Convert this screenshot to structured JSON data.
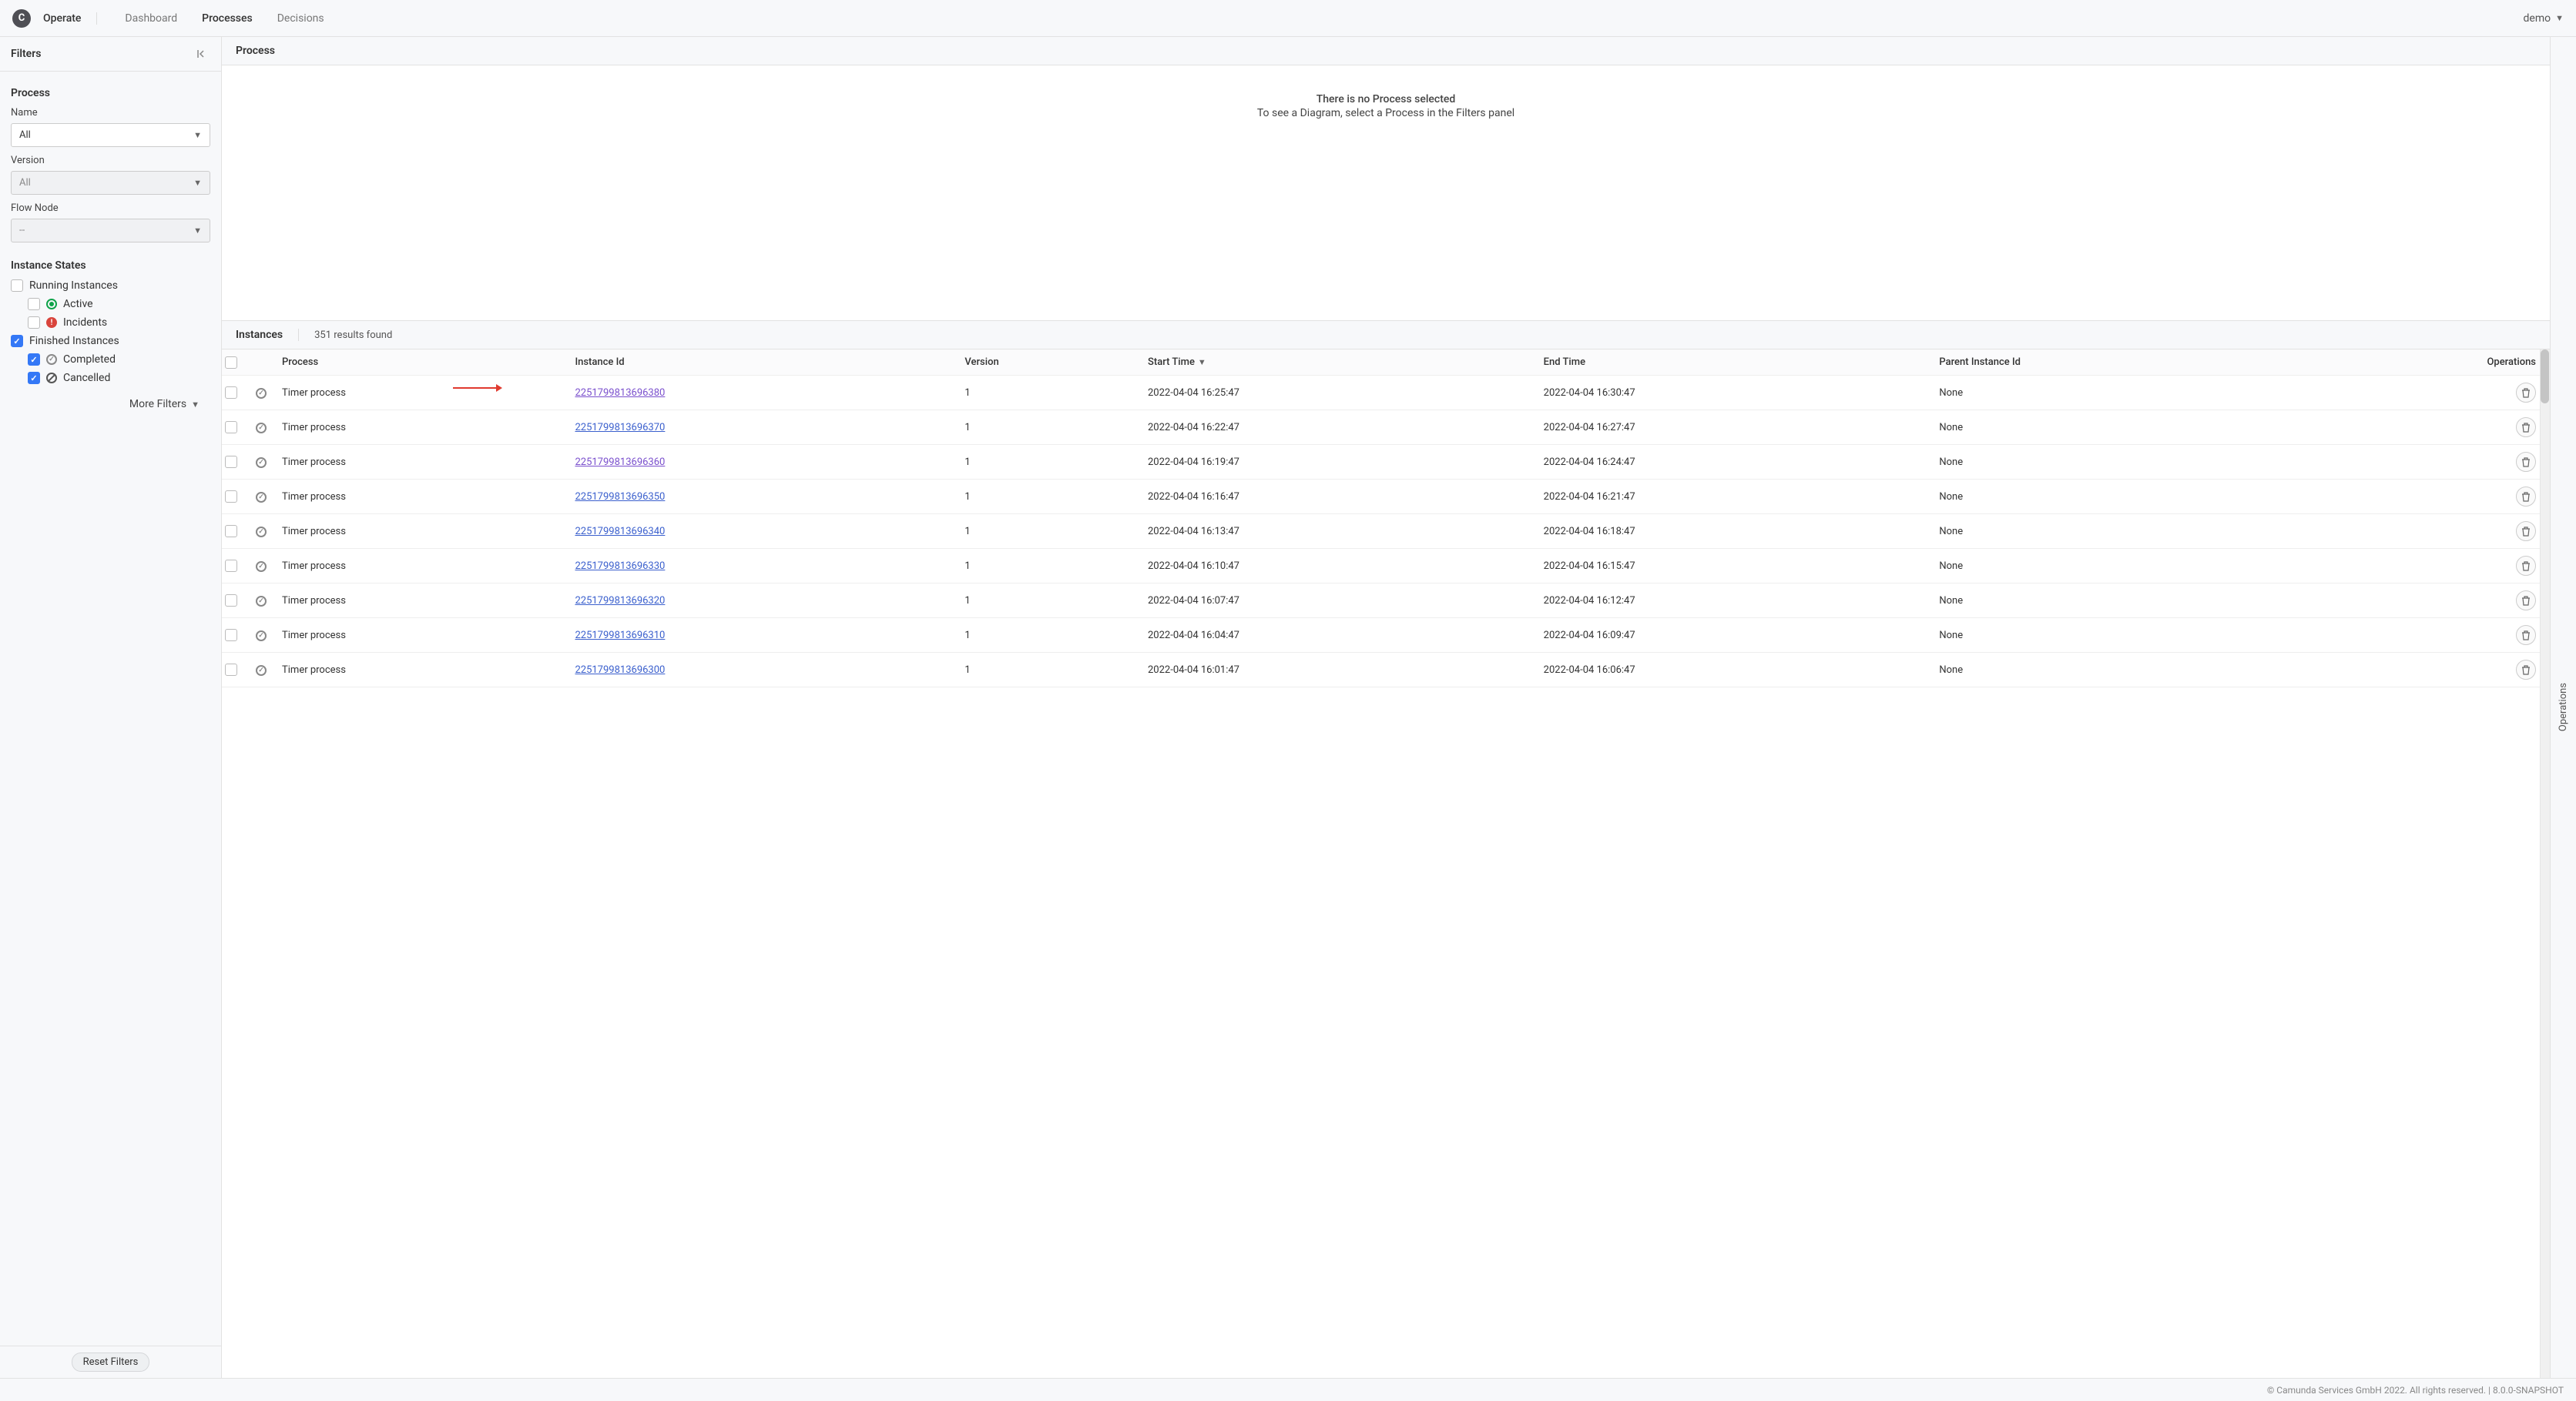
{
  "header": {
    "brand": "Operate",
    "logo_letter": "C",
    "nav": [
      "Dashboard",
      "Processes",
      "Decisions"
    ],
    "active_nav": "Processes",
    "user": "demo"
  },
  "sidebar": {
    "title": "Filters",
    "process_section": "Process",
    "name_label": "Name",
    "name_value": "All",
    "version_label": "Version",
    "version_value": "All",
    "flownode_label": "Flow Node",
    "flownode_value": "--",
    "states_section": "Instance States",
    "running_label": "Running Instances",
    "active_label": "Active",
    "incidents_label": "Incidents",
    "finished_label": "Finished Instances",
    "completed_label": "Completed",
    "cancelled_label": "Cancelled",
    "more_filters": "More Filters",
    "reset": "Reset Filters",
    "running_checked": false,
    "active_checked": false,
    "incidents_checked": false,
    "finished_checked": true,
    "completed_checked": true,
    "cancelled_checked": true
  },
  "process_panel": {
    "title": "Process",
    "empty_line1": "There is no Process selected",
    "empty_line2": "To see a Diagram, select a Process in the Filters panel"
  },
  "instances": {
    "title": "Instances",
    "results": "351 results found",
    "columns": {
      "process": "Process",
      "instance_id": "Instance Id",
      "version": "Version",
      "start_time": "Start Time",
      "end_time": "End Time",
      "parent": "Parent Instance Id",
      "operations": "Operations"
    },
    "rows": [
      {
        "process": "Timer process",
        "id": "2251799813696380",
        "visited": true,
        "version": "1",
        "start": "2022-04-04 16:25:47",
        "end": "2022-04-04 16:30:47",
        "parent": "None",
        "arrow": true
      },
      {
        "process": "Timer process",
        "id": "2251799813696370",
        "visited": false,
        "version": "1",
        "start": "2022-04-04 16:22:47",
        "end": "2022-04-04 16:27:47",
        "parent": "None"
      },
      {
        "process": "Timer process",
        "id": "2251799813696360",
        "visited": true,
        "version": "1",
        "start": "2022-04-04 16:19:47",
        "end": "2022-04-04 16:24:47",
        "parent": "None"
      },
      {
        "process": "Timer process",
        "id": "2251799813696350",
        "visited": false,
        "version": "1",
        "start": "2022-04-04 16:16:47",
        "end": "2022-04-04 16:21:47",
        "parent": "None"
      },
      {
        "process": "Timer process",
        "id": "2251799813696340",
        "visited": false,
        "version": "1",
        "start": "2022-04-04 16:13:47",
        "end": "2022-04-04 16:18:47",
        "parent": "None"
      },
      {
        "process": "Timer process",
        "id": "2251799813696330",
        "visited": false,
        "version": "1",
        "start": "2022-04-04 16:10:47",
        "end": "2022-04-04 16:15:47",
        "parent": "None"
      },
      {
        "process": "Timer process",
        "id": "2251799813696320",
        "visited": false,
        "version": "1",
        "start": "2022-04-04 16:07:47",
        "end": "2022-04-04 16:12:47",
        "parent": "None"
      },
      {
        "process": "Timer process",
        "id": "2251799813696310",
        "visited": false,
        "version": "1",
        "start": "2022-04-04 16:04:47",
        "end": "2022-04-04 16:09:47",
        "parent": "None"
      },
      {
        "process": "Timer process",
        "id": "2251799813696300",
        "visited": false,
        "version": "1",
        "start": "2022-04-04 16:01:47",
        "end": "2022-04-04 16:06:47",
        "parent": "None"
      }
    ]
  },
  "operations_panel": "Operations",
  "footer": "© Camunda Services GmbH 2022. All rights reserved. | 8.0.0-SNAPSHOT"
}
